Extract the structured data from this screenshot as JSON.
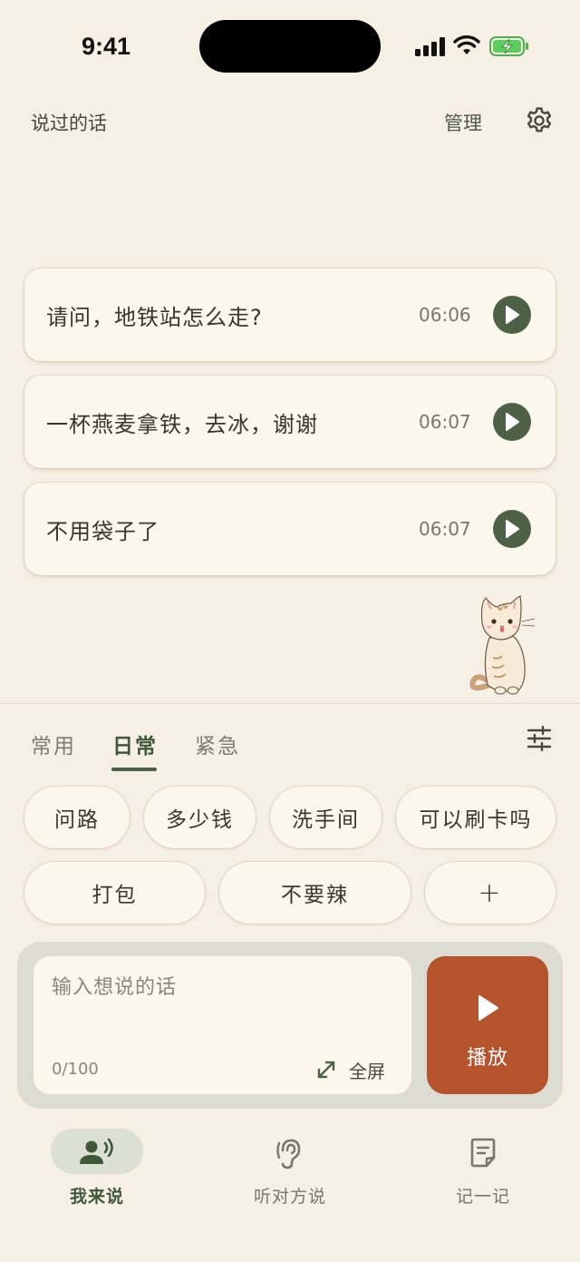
{
  "status_bar": {
    "time": "9:41"
  },
  "header": {
    "title": "说过的话",
    "manage_label": "管理"
  },
  "phrases": [
    {
      "text": "请问，地铁站怎么走?",
      "time": "06:06"
    },
    {
      "text": "一杯燕麦拿铁，去冰，谢谢",
      "time": "06:07"
    },
    {
      "text": "不用袋子了",
      "time": "06:07"
    }
  ],
  "tabs": [
    {
      "label": "常用",
      "active": false
    },
    {
      "label": "日常",
      "active": true
    },
    {
      "label": "紧急",
      "active": false
    }
  ],
  "chips": {
    "row1": [
      "问路",
      "多少钱",
      "洗手间",
      "可以刷卡吗"
    ],
    "row2": [
      "打包",
      "不要辣",
      "+"
    ]
  },
  "input": {
    "placeholder": "输入想说的话",
    "value": "",
    "char_count": "0/100",
    "fullscreen_label": "全屏"
  },
  "play_button": {
    "label": "播放"
  },
  "bottom_nav": [
    {
      "label": "我来说",
      "icon": "speaking-person-icon",
      "active": true
    },
    {
      "label": "听对方说",
      "icon": "ear-icon",
      "active": false
    },
    {
      "label": "记一记",
      "icon": "note-icon",
      "active": false
    }
  ],
  "colors": {
    "background": "#f6efe3",
    "card": "#fbf7ec",
    "accent_green": "#4c6146",
    "play_orange": "#b4532c"
  }
}
